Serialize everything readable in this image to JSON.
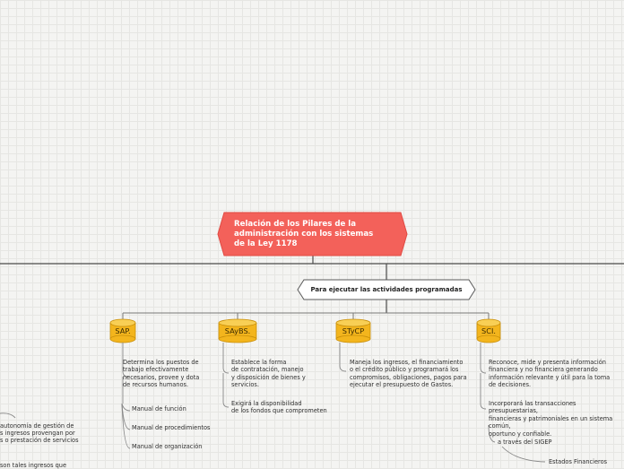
{
  "root": {
    "lines": [
      "Relación de los Pilares de la",
      "administración con los sistemas",
      "de la Ley 1178"
    ],
    "color": "#f3615a"
  },
  "connector": {
    "label": "Para ejecutar las actividades programadas"
  },
  "systems": [
    {
      "label": "SAP.",
      "descriptions": [
        "Determina los puestos de\ntrabajo efectivamente\nnecesarios, provee y dota\nde recursos humanos."
      ],
      "children": [
        "Manual de función",
        "Manual de procedimientos",
        "Manual de organización"
      ]
    },
    {
      "label": "SAyBS.",
      "descriptions": [
        "Establece la forma\nde contratación, manejo\ny disposición de bienes y\nservicios.",
        "Exigirá la disponibilidad\nde los fondos que comprometen"
      ]
    },
    {
      "label": "STyCP",
      "descriptions": [
        "Maneja los ingresos, el financiamiento\no el crédito público y programará los\ncompromisos, obligaciones, pagos para\nejecutar el presupuesto de Gastos."
      ]
    },
    {
      "label": "SCI.",
      "descriptions": [
        "Reconoce, mide y presenta información\nfinanciera y no financiera generando\ninformación relevante y útil para la toma\nde decisiones.",
        "Incorporará las transacciones presupuestarias,\nfinancieras y patrimoniales en un sistema común,\noportuno y confiable."
      ],
      "children": [
        "a través del SIGEP",
        "Estados Financieros"
      ]
    }
  ],
  "left_fragment": [
    "autonomía de gestión de",
    "s ingresos provengan por",
    "s o prestación de servicios",
    "son tales ingresos que"
  ],
  "colors": {
    "cylinder": "#f3b51d",
    "cylinder_top": "#f8cf55",
    "line": "#8a8a8a",
    "dark_line": "#4a4a4a"
  }
}
